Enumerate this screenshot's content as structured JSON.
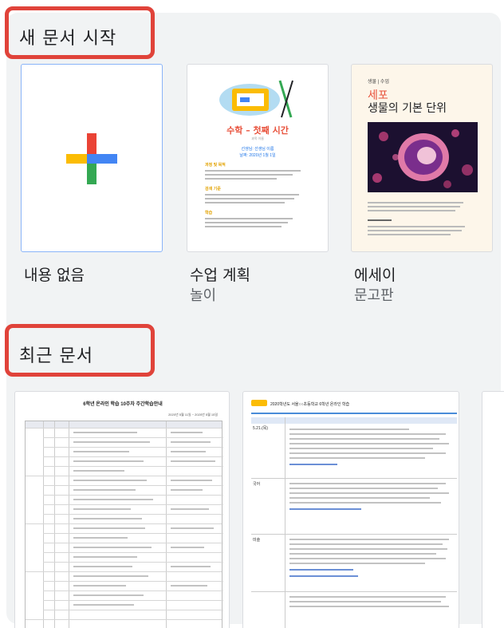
{
  "new_section": {
    "title": "새 문서 시작",
    "templates": [
      {
        "name": "내용 없음",
        "sub": ""
      },
      {
        "name": "수업 계획",
        "sub": "놀이",
        "preview": {
          "title": "수학 – 첫째 시간",
          "subtitle": "과목 이름",
          "meta1": "선생님: 선생님 이름",
          "meta2": "날짜: 2020년 1월 1일",
          "head1": "과정 및 목적",
          "head2": "검색 기준",
          "head3": "학습"
        }
      },
      {
        "name": "에세이",
        "sub": "문고판",
        "preview": {
          "top": "생물 | 수업",
          "red": "세포",
          "title": "생물의 기본 단위"
        }
      }
    ]
  },
  "recent_section": {
    "title": "최근 문서",
    "docs": [
      {
        "header": "6학년 온라인 학습 10주차 주간학습안내",
        "date": "2020년 5월 11일 ~ 2020년 5월 15일"
      },
      {
        "header": "2020학년도 서울○○초등학교 6학년 온라인 학습",
        "rows": [
          "5.21.(목)",
          "국어",
          "미술"
        ]
      }
    ]
  },
  "colors": {
    "plus_blue": "#4285f4",
    "plus_red": "#ea4335",
    "plus_yellow": "#fbbc04",
    "plus_green": "#34a853",
    "highlight": "#e0433a"
  }
}
